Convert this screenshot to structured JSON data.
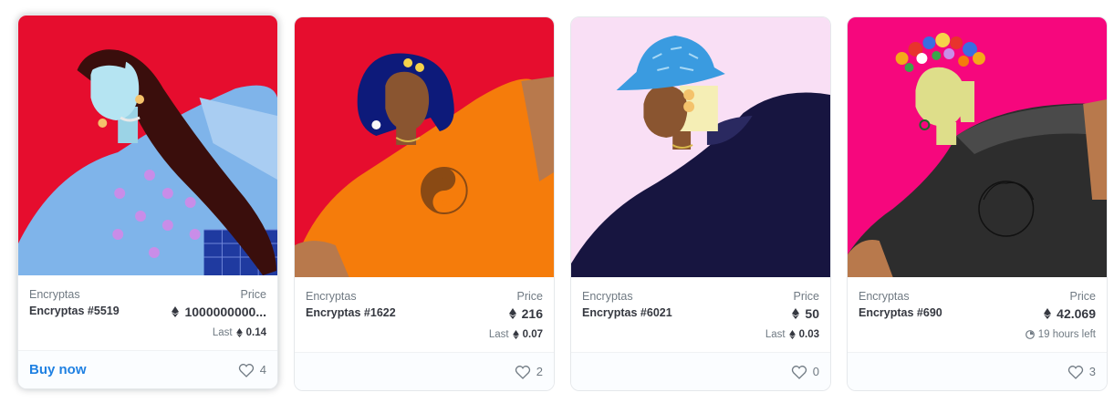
{
  "colors": {
    "accent": "#2081e2",
    "text": "#353840",
    "muted": "#707a83",
    "card_border": "#e5e8eb"
  },
  "cards": [
    {
      "collection": "Encryptas",
      "name": "Encryptas #5519",
      "price_label": "Price",
      "price": "1000000000...",
      "price_icon": "eth-icon",
      "last_label": "Last",
      "last_price": "0.14",
      "buy_label": "Buy now",
      "likes": "4",
      "hovered": true,
      "art_background": "#e60d2e"
    },
    {
      "collection": "Encryptas",
      "name": "Encryptas #1622",
      "price_label": "Price",
      "price": "216",
      "price_icon": "eth-icon",
      "last_label": "Last",
      "last_price": "0.07",
      "likes": "2",
      "hovered": false,
      "art_background": "#e60d2e"
    },
    {
      "collection": "Encryptas",
      "name": "Encryptas #6021",
      "price_label": "Price",
      "price": "50",
      "price_icon": "eth-icon",
      "last_label": "Last",
      "last_price": "0.03",
      "likes": "0",
      "hovered": false,
      "art_background": "#f9dff5"
    },
    {
      "collection": "Encryptas",
      "name": "Encryptas #690",
      "price_label": "Price",
      "price": "42.069",
      "price_icon": "eth-icon",
      "time_left": "19 hours left",
      "time_icon": "clock-icon",
      "likes": "3",
      "hovered": false,
      "art_background": "#f6077d"
    }
  ]
}
